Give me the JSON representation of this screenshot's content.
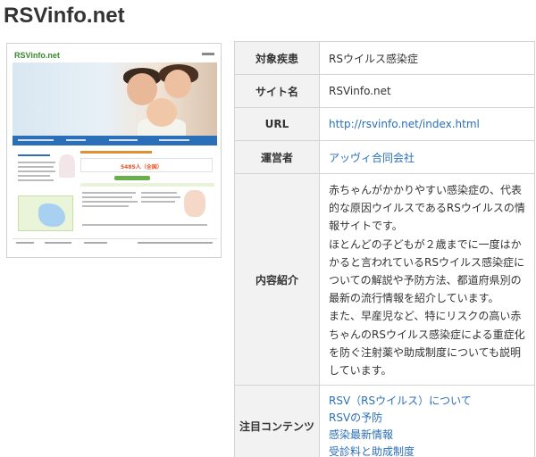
{
  "page": {
    "title": "RSVinfo.net"
  },
  "thumbnail": {
    "logo": "RSVinfo.net",
    "count": "5485人（全国）"
  },
  "table": {
    "rows": [
      {
        "header": "対象疾患",
        "value": "RSウイルス感染症"
      },
      {
        "header": "サイト名",
        "value": "RSVinfo.net"
      },
      {
        "header": "URL",
        "value": "http://rsvinfo.net/index.html"
      },
      {
        "header": "運営者",
        "value": "アッヴィ合同会社"
      },
      {
        "header": "内容紹介",
        "paragraphs": [
          "赤ちゃんがかかりやすい感染症の、代表的な原因ウイルスであるRSウイルスの情報サイトです。",
          "ほとんどの子どもが２歳までに一度はかかると言われているRSウイルス感染症についての解説や予防方法、都道府県別の最新の流行情報を紹介しています。",
          "また、早産児など、特にリスクの高い赤ちゃんのRSウイルス感染症による重症化を防ぐ注射薬や助成制度についても説明しています。"
        ]
      },
      {
        "header": "注目コンテンツ",
        "links": [
          "RSV（RSウイルス）について",
          "RSVの予防",
          "感染最新情報",
          "受診料と助成制度"
        ]
      }
    ]
  },
  "colors": {
    "link": "#2a6fb8",
    "header_bg": "#f2f2f2",
    "border": "#d4d4d4"
  }
}
